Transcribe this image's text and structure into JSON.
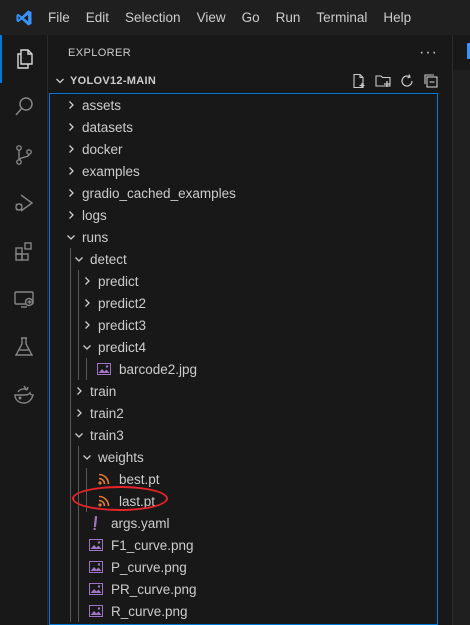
{
  "menu": [
    "File",
    "Edit",
    "Selection",
    "View",
    "Go",
    "Run",
    "Terminal",
    "Help"
  ],
  "activity_items": [
    "files-icon",
    "search-icon",
    "source-control-icon",
    "run-debug-icon",
    "extensions-icon",
    "remote-explorer-icon",
    "testing-icon",
    "docker-whale-icon"
  ],
  "explorer": {
    "title": "EXPLORER",
    "more": "···",
    "root": "YOLOV12-MAIN",
    "items": [
      {
        "label": "assets",
        "type": "folder",
        "depth": 0,
        "open": false
      },
      {
        "label": "datasets",
        "type": "folder",
        "depth": 0,
        "open": false
      },
      {
        "label": "docker",
        "type": "folder",
        "depth": 0,
        "open": false
      },
      {
        "label": "examples",
        "type": "folder",
        "depth": 0,
        "open": false
      },
      {
        "label": "gradio_cached_examples",
        "type": "folder",
        "depth": 0,
        "open": false
      },
      {
        "label": "logs",
        "type": "folder",
        "depth": 0,
        "open": false
      },
      {
        "label": "runs",
        "type": "folder",
        "depth": 0,
        "open": true
      },
      {
        "label": "detect",
        "type": "folder",
        "depth": 1,
        "open": true
      },
      {
        "label": "predict",
        "type": "folder",
        "depth": 2,
        "open": false
      },
      {
        "label": "predict2",
        "type": "folder",
        "depth": 2,
        "open": false
      },
      {
        "label": "predict3",
        "type": "folder",
        "depth": 2,
        "open": false
      },
      {
        "label": "predict4",
        "type": "folder",
        "depth": 2,
        "open": true
      },
      {
        "label": "barcode2.jpg",
        "type": "image",
        "depth": 3
      },
      {
        "label": "train",
        "type": "folder",
        "depth": 1,
        "open": false
      },
      {
        "label": "train2",
        "type": "folder",
        "depth": 1,
        "open": false
      },
      {
        "label": "train3",
        "type": "folder",
        "depth": 1,
        "open": true
      },
      {
        "label": "weights",
        "type": "folder",
        "depth": 2,
        "open": true
      },
      {
        "label": "best.pt",
        "type": "rss",
        "depth": 3
      },
      {
        "label": "last.pt",
        "type": "rss",
        "depth": 3
      },
      {
        "label": "args.yaml",
        "type": "yaml",
        "depth": 2
      },
      {
        "label": "F1_curve.png",
        "type": "image",
        "depth": 2
      },
      {
        "label": "P_curve.png",
        "type": "image",
        "depth": 2
      },
      {
        "label": "PR_curve.png",
        "type": "image",
        "depth": 2
      },
      {
        "label": "R_curve.png",
        "type": "image",
        "depth": 2
      }
    ]
  },
  "colors": {
    "accent": "#0078d4",
    "rss": "#e37933",
    "yaml": "#a074c4",
    "image": "#a074c4",
    "annotation": "#e8242b"
  }
}
